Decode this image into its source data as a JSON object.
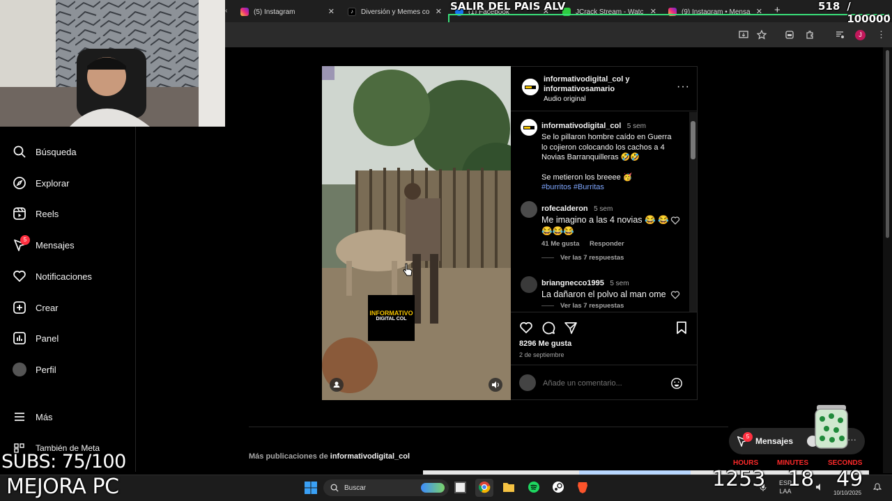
{
  "stream": {
    "banner": "SALIR DEL PAIS ALV",
    "counter_current": "518",
    "counter_goal": "/ 100000",
    "subs": "SUBS: 75/100",
    "channel": "MEJORA PC",
    "viewers": "1253",
    "timer_hours_label": "HOURS",
    "timer_minutes_label": "MINUTES",
    "timer_seconds_label": "SECONDS",
    "timer_minutes": "18",
    "timer_seconds": "49"
  },
  "browser": {
    "tabs": [
      {
        "title": "(5) Instagram",
        "icon": "instagram-icon"
      },
      {
        "title": "Diversión y Memes co",
        "icon": "tiktok-icon"
      },
      {
        "title": "(1) Facebook",
        "icon": "facebook-icon"
      },
      {
        "title": "JCrack Stream - Watc",
        "icon": "stream-icon"
      },
      {
        "title": "(9) Instagram • Mensa",
        "icon": "instagram-icon"
      }
    ],
    "profile_initial": "J"
  },
  "sidebar": {
    "items": [
      {
        "label": "Búsqueda",
        "icon": "search-icon"
      },
      {
        "label": "Explorar",
        "icon": "compass-icon"
      },
      {
        "label": "Reels",
        "icon": "reels-icon"
      },
      {
        "label": "Mensajes",
        "icon": "messenger-icon",
        "badge": "5"
      },
      {
        "label": "Notificaciones",
        "icon": "heart-icon"
      },
      {
        "label": "Crear",
        "icon": "plus-square-icon"
      },
      {
        "label": "Panel",
        "icon": "chart-icon"
      },
      {
        "label": "Perfil",
        "icon": "avatar"
      }
    ],
    "more": "Más",
    "meta": "También de Meta"
  },
  "post": {
    "author_line1": "informativodigital_col y",
    "author_line2": "informativosamario",
    "audio": "Audio original",
    "video_logo_line1": "INFORMATIVO",
    "video_logo_line2": "DIGITAL COL",
    "caption": {
      "user": "informativodigital_col",
      "time": "5 sem",
      "text": "Se lo pillaron hombre caído en Guerra lo cojieron colocando los cachos a 4 Novias Barranquilleras 🤣🤣",
      "text2": "Se metieron los breeee 🥳",
      "tags": "#burritos #Burritas"
    },
    "comments": [
      {
        "user": "rofecalderon",
        "time": "5 sem",
        "text": "Me imagino a las 4 novias 😂 😂😂😂😂",
        "likes": "41 Me gusta",
        "reply": "Responder",
        "view_replies": "Ver las 7 respuestas"
      },
      {
        "user": "briangnecco1995",
        "time": "5 sem",
        "text": "La dañaron el polvo al man ome"
      }
    ],
    "likes": "8296 Me gusta",
    "date": "2 de septiembre",
    "comment_placeholder": "Añade un comentario..."
  },
  "more_posts": {
    "prefix": "Más publicaciones de",
    "user": "informativodigital_col"
  },
  "messages_pill": {
    "label": "Mensajes",
    "badge": "5"
  },
  "taskbar": {
    "search_label": "Buscar",
    "lang_line1": "ESP",
    "lang_line2": "LAA",
    "date": "10/10/2025"
  },
  "colors": {
    "instagram_bg": "#000000",
    "badge_red": "#ff3040",
    "link_blue": "#7fa7ff",
    "timer_red": "#ff2a2a"
  }
}
